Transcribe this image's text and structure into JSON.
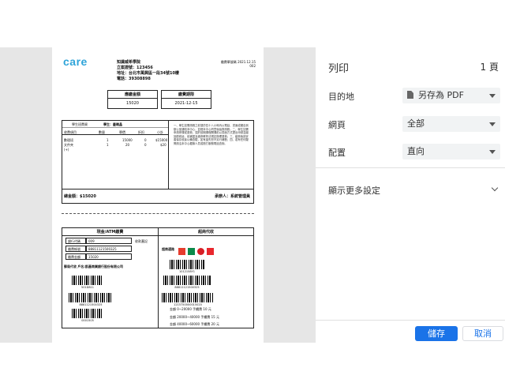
{
  "document": {
    "logo": "care",
    "school_name": "知識威希學院",
    "tax_id": "立案證號：123456",
    "address": "地址：台北市萬興區一段34號10樓",
    "phone": "電話：39308898",
    "bill_no_label": "繳費單號碼 2021.12.15",
    "bill_no_value": "002",
    "amount_box": {
      "label": "應繳金額",
      "value": "15020"
    },
    "due_box": {
      "label": "繳費期限",
      "value": "2021-12-15"
    },
    "detail": {
      "class_label": "學生班費資",
      "student_label": "學生：藝曉晶",
      "columns": [
        "收費項目",
        "數量",
        "單價",
        "折扣",
        "小計"
      ],
      "rows": [
        {
          "item": "數理班",
          "qty": "1",
          "price": "15000",
          "discount": "0",
          "subtotal": "$15000"
        },
        {
          "item": "文件夾",
          "qty": "1",
          "price": "20",
          "discount": "0",
          "subtotal": "$20"
        },
        {
          "item": "(+)",
          "qty": "",
          "price": "",
          "discount": "",
          "subtotal": ""
        }
      ],
      "notes": "一、學生如需請假之前須於四十八小時內以電話、書面或親自到辦公室通知本中心，並經本中心同意後始算請假；二、學生如需申請停課或退費，須於該期課程開課前以書面方式提出申請並繳回原收據，依補習及進修教育法規定辦理退費；三、繳費後請妥善保存收據以備查驗，如有遺失恕不另行補發；四、若有任何疑問請洽本中心櫃檯人員或撥打服務電話查詢。",
      "total": "總金額：$15020",
      "handler": "承辦人：系統管理員"
    },
    "payment": {
      "cash_title": "現金/ATM繳費",
      "counter_title": "超商代收",
      "receipt_label": "收款蓋記",
      "bank_code_label": "銀行代碼",
      "bank_code": "009",
      "account_label": "繳費帳號",
      "account": "88811121500325",
      "amount_label": "繳費金額",
      "amount": "15020",
      "postal_text": "郵局代收 戶名:凱基商業銀行股份有限公司",
      "store_label": "超商通路",
      "barcodes_left": [
        "501D811",
        "8881121500325",
        "0001505"
      ],
      "barcodes_right": [
        "1012158Y1",
        "88811121500325",
        "1215750000015020"
      ],
      "fees": [
        "金額 0~20000 手續費 10 元",
        "金額 20000~40000 手續費 15 元",
        "金額 40000~60000 手續費 20 元"
      ]
    }
  },
  "panel": {
    "title": "列印",
    "pages": "1 頁",
    "destination_label": "目的地",
    "destination_value": "另存為 PDF",
    "pages_label": "網頁",
    "pages_value": "全部",
    "layout_label": "配置",
    "layout_value": "直向",
    "more_settings": "顯示更多設定",
    "save": "儲存",
    "cancel": "取消"
  }
}
